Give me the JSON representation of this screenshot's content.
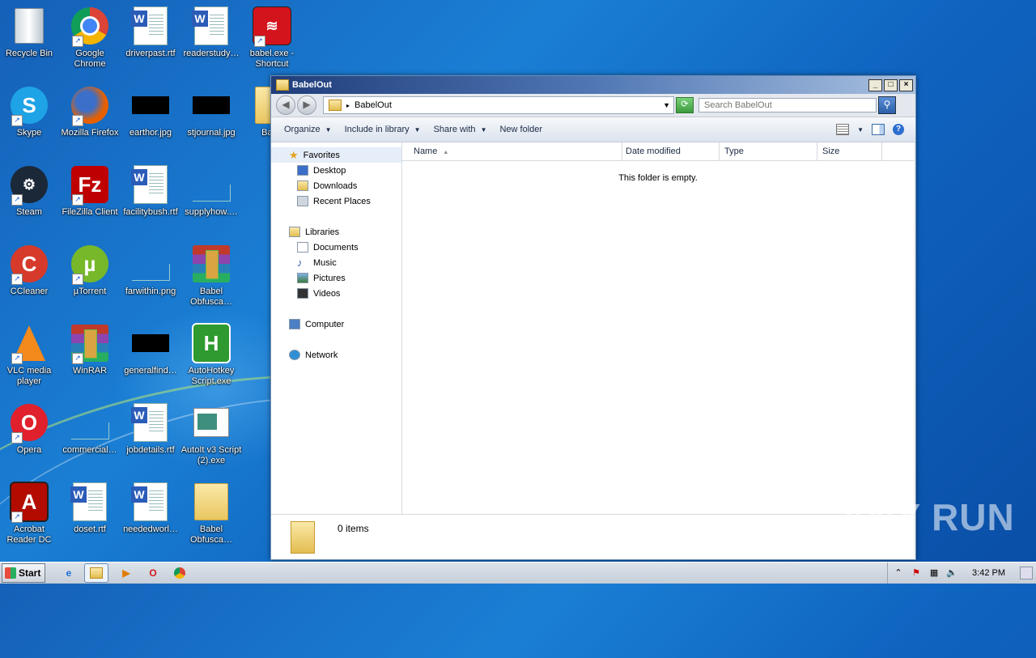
{
  "desktop": {
    "icons": [
      {
        "label": "Recycle Bin",
        "icon": "recycle-bin-icon"
      },
      {
        "label": "Google Chrome",
        "icon": "chrome-icon"
      },
      {
        "label": "driverpast.rtf",
        "icon": "word-document-icon"
      },
      {
        "label": "readerstudy…",
        "icon": "word-document-icon"
      },
      {
        "label": "babel.exe - Shortcut",
        "icon": "babel-app-icon"
      },
      {
        "label": "Skype",
        "icon": "skype-icon"
      },
      {
        "label": "Mozilla Firefox",
        "icon": "firefox-icon"
      },
      {
        "label": "earthor.jpg",
        "icon": "image-thumbnail-icon"
      },
      {
        "label": "stjournal.jpg",
        "icon": "image-thumbnail-icon"
      },
      {
        "label": "Babe",
        "icon": "folder-icon"
      },
      {
        "label": "Steam",
        "icon": "steam-icon"
      },
      {
        "label": "FileZilla Client",
        "icon": "filezilla-icon"
      },
      {
        "label": "facilitybush.rtf",
        "icon": "word-document-icon"
      },
      {
        "label": "supplyhow.…",
        "icon": "blank-file-icon"
      },
      {
        "label": "CCleaner",
        "icon": "ccleaner-icon"
      },
      {
        "label": "µTorrent",
        "icon": "utorrent-icon"
      },
      {
        "label": "farwithin.png",
        "icon": "blank-file-icon"
      },
      {
        "label": "Babel Obfusca…",
        "icon": "winrar-archive-icon"
      },
      {
        "label": "VLC media player",
        "icon": "vlc-icon"
      },
      {
        "label": "WinRAR",
        "icon": "winrar-icon"
      },
      {
        "label": "generalfind…",
        "icon": "image-thumbnail-icon"
      },
      {
        "label": "AutoHotkey Script.exe",
        "icon": "autohotkey-icon"
      },
      {
        "label": "Opera",
        "icon": "opera-icon"
      },
      {
        "label": "commercial…",
        "icon": "blank-file-icon"
      },
      {
        "label": "jobdetails.rtf",
        "icon": "word-document-icon"
      },
      {
        "label": "AutoIt v3 Script (2).exe",
        "icon": "autoit-icon"
      },
      {
        "label": "Acrobat Reader DC",
        "icon": "acrobat-icon"
      },
      {
        "label": "doset.rtf",
        "icon": "word-document-icon"
      },
      {
        "label": "neededworl…",
        "icon": "word-document-icon"
      },
      {
        "label": "Babel Obfusca…",
        "icon": "folder-icon"
      }
    ]
  },
  "window": {
    "title": "BabelOut",
    "address": "BabelOut",
    "search_placeholder": "Search BabelOut",
    "commands": [
      "Organize",
      "Include in library",
      "Share with",
      "New folder"
    ],
    "nav": {
      "favorites": "Favorites",
      "favorites_items": [
        "Desktop",
        "Downloads",
        "Recent Places"
      ],
      "libraries": "Libraries",
      "libraries_items": [
        "Documents",
        "Music",
        "Pictures",
        "Videos"
      ],
      "computer": "Computer",
      "network": "Network"
    },
    "columns": [
      "Name",
      "Date modified",
      "Type",
      "Size"
    ],
    "empty_message": "This folder is empty.",
    "item_count": "0 items"
  },
  "taskbar": {
    "start_label": "Start",
    "clock": "3:42 PM"
  },
  "watermark": "ANY RUN"
}
